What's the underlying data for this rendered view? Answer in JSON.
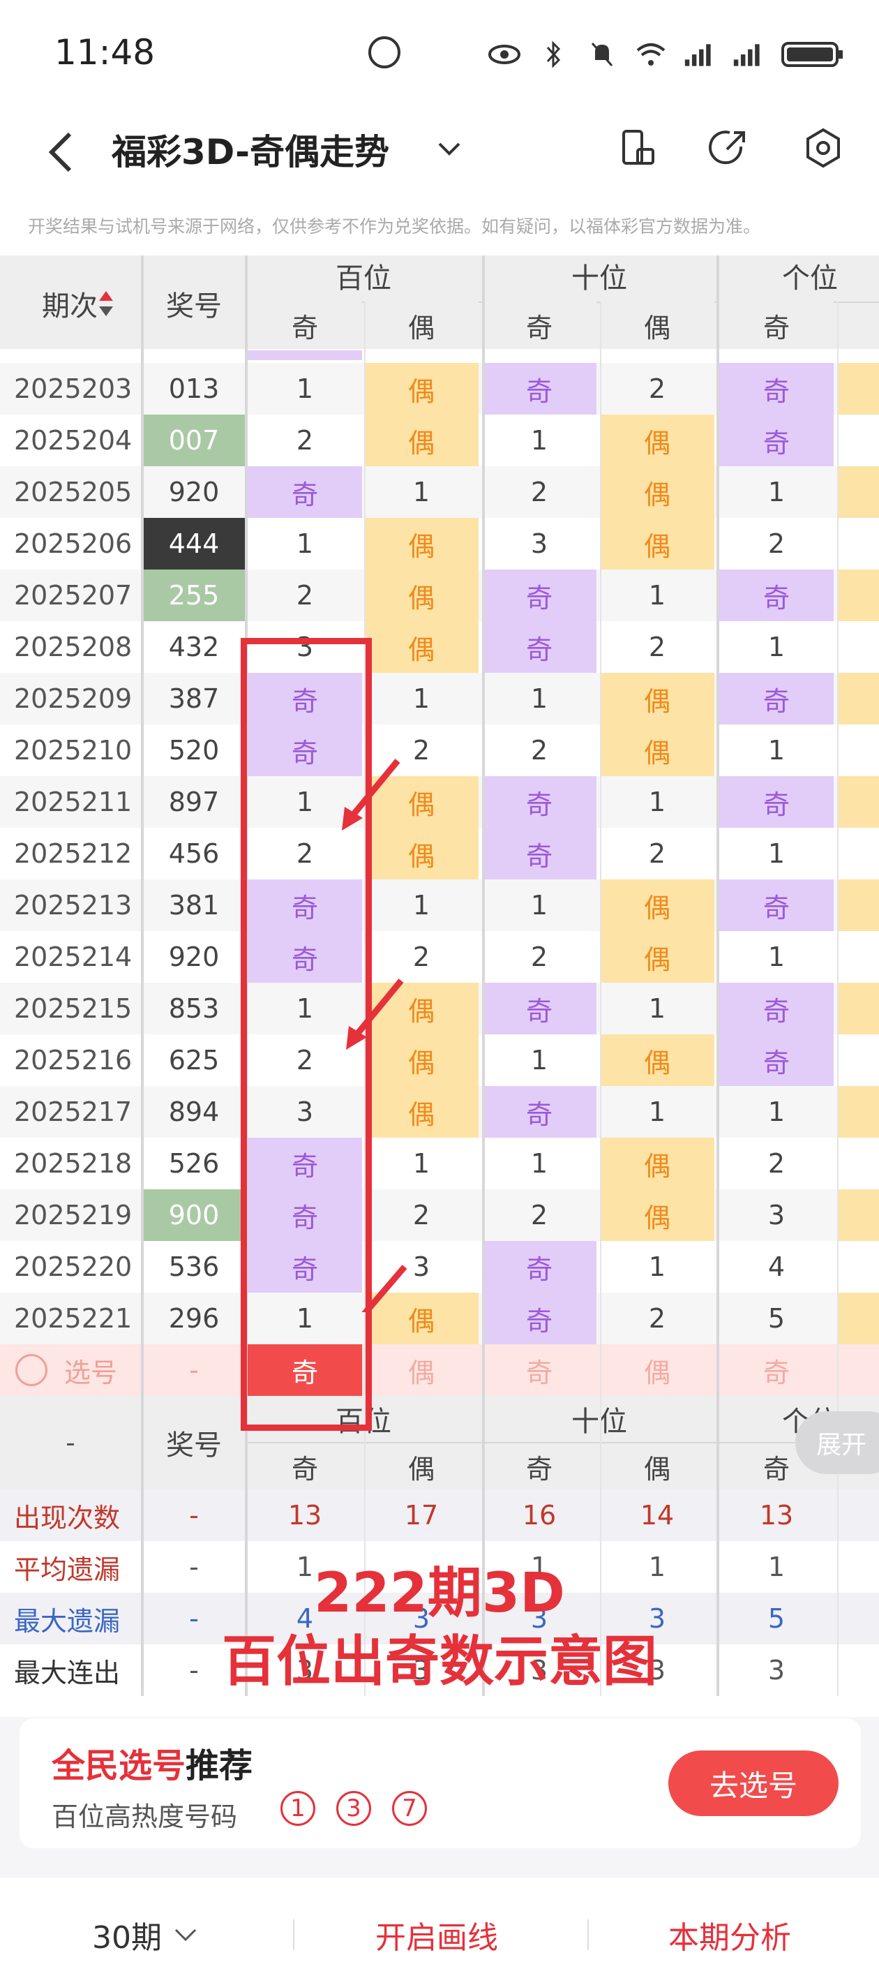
{
  "status": {
    "time": "11:48"
  },
  "header": {
    "title": "福彩3D-奇偶走势"
  },
  "notice": "开奖结果与试机号来源于网络，仅供参考不作为兑奖依据。如有疑问，以福体彩官方数据为准。",
  "columns": {
    "period": "期次",
    "number": "奖号",
    "groups": [
      "百位",
      "十位",
      "个位"
    ],
    "odd": "奇",
    "even": "偶"
  },
  "rows": [
    {
      "period": "2025203",
      "num": "013",
      "b": [
        "1",
        "偶"
      ],
      "s": [
        "奇",
        "2"
      ],
      "g": "奇"
    },
    {
      "period": "2025204",
      "num": "007",
      "b": [
        "2",
        "偶"
      ],
      "s": [
        "1",
        "偶"
      ],
      "g": "奇"
    },
    {
      "period": "2025205",
      "num": "920",
      "b": [
        "奇",
        "1"
      ],
      "s": [
        "2",
        "偶"
      ],
      "g": "1"
    },
    {
      "period": "2025206",
      "num": "444",
      "b": [
        "1",
        "偶"
      ],
      "s": [
        "3",
        "偶"
      ],
      "g": "2"
    },
    {
      "period": "2025207",
      "num": "255",
      "b": [
        "2",
        "偶"
      ],
      "s": [
        "奇",
        "1"
      ],
      "g": "奇"
    },
    {
      "period": "2025208",
      "num": "432",
      "b": [
        "3",
        "偶"
      ],
      "s": [
        "奇",
        "2"
      ],
      "g": "1"
    },
    {
      "period": "2025209",
      "num": "387",
      "b": [
        "奇",
        "1"
      ],
      "s": [
        "1",
        "偶"
      ],
      "g": "奇"
    },
    {
      "period": "2025210",
      "num": "520",
      "b": [
        "奇",
        "2"
      ],
      "s": [
        "2",
        "偶"
      ],
      "g": "1"
    },
    {
      "period": "2025211",
      "num": "897",
      "b": [
        "1",
        "偶"
      ],
      "s": [
        "奇",
        "1"
      ],
      "g": "奇"
    },
    {
      "period": "2025212",
      "num": "456",
      "b": [
        "2",
        "偶"
      ],
      "s": [
        "奇",
        "2"
      ],
      "g": "1"
    },
    {
      "period": "2025213",
      "num": "381",
      "b": [
        "奇",
        "1"
      ],
      "s": [
        "1",
        "偶"
      ],
      "g": "奇"
    },
    {
      "period": "2025214",
      "num": "920",
      "b": [
        "奇",
        "2"
      ],
      "s": [
        "2",
        "偶"
      ],
      "g": "1"
    },
    {
      "period": "2025215",
      "num": "853",
      "b": [
        "1",
        "偶"
      ],
      "s": [
        "奇",
        "1"
      ],
      "g": "奇"
    },
    {
      "period": "2025216",
      "num": "625",
      "b": [
        "2",
        "偶"
      ],
      "s": [
        "1",
        "偶"
      ],
      "g": "奇"
    },
    {
      "period": "2025217",
      "num": "894",
      "b": [
        "3",
        "偶"
      ],
      "s": [
        "奇",
        "1"
      ],
      "g": "1"
    },
    {
      "period": "2025218",
      "num": "526",
      "b": [
        "奇",
        "1"
      ],
      "s": [
        "1",
        "偶"
      ],
      "g": "2"
    },
    {
      "period": "2025219",
      "num": "900",
      "b": [
        "奇",
        "2"
      ],
      "s": [
        "2",
        "偶"
      ],
      "g": "3"
    },
    {
      "period": "2025220",
      "num": "536",
      "b": [
        "奇",
        "3"
      ],
      "s": [
        "奇",
        "1"
      ],
      "g": "4"
    },
    {
      "period": "2025221",
      "num": "296",
      "b": [
        "1",
        "偶"
      ],
      "s": [
        "奇",
        "2"
      ],
      "g": "5"
    }
  ],
  "select_row": {
    "label": "选号",
    "dash": "-",
    "cells": [
      "奇",
      "偶",
      "奇",
      "偶",
      "奇"
    ]
  },
  "stats": {
    "dash": "-",
    "number_label": "奖号",
    "rows": [
      {
        "label": "出现次数",
        "values": [
          "13",
          "17",
          "16",
          "14",
          "13"
        ]
      },
      {
        "label": "平均遗漏",
        "values": [
          "1",
          "",
          "1",
          "1",
          "1"
        ]
      },
      {
        "label": "最大遗漏",
        "values": [
          "4",
          "3",
          "3",
          "3",
          "5"
        ]
      },
      {
        "label": "最大连出",
        "values": [
          "3",
          "3",
          "3",
          "3",
          "3"
        ]
      }
    ]
  },
  "annotation": {
    "line1": "222期3D",
    "line2": "百位出奇数示意图"
  },
  "expand_label": "展开",
  "recommend": {
    "title_red": "全民选号",
    "title_black": "推荐",
    "subtitle": "百位高热度号码",
    "balls": [
      "1",
      "3",
      "7"
    ],
    "button": "去选号"
  },
  "footer": {
    "periods": "30期",
    "draw_line": "开启画线",
    "analysis": "本期分析"
  },
  "colors": {
    "odd_bg": "#e2cdf9",
    "even_bg": "#fde3a6",
    "accent": "#e5313a"
  }
}
